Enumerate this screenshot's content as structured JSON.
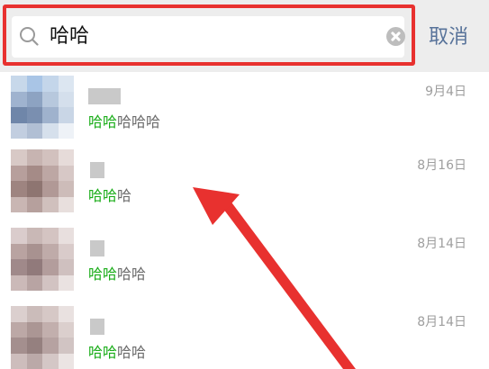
{
  "search": {
    "query": "哈哈",
    "cancel_label": "取消"
  },
  "results": [
    {
      "time": "9月4日",
      "highlight": "哈哈",
      "rest": "哈哈哈",
      "avatar_colors": [
        "#c7d8ea",
        "#a9c5e6",
        "#c4d6ea",
        "#dce6f1",
        "#9fb3cf",
        "#8da3c2",
        "#b7c8dd",
        "#d4dfec",
        "#6f86a9",
        "#7a8fb0",
        "#9fb2cd",
        "#c9d6e6",
        "#c2cee0",
        "#b1bfd4",
        "#d6e0ec",
        "#eef2f7"
      ]
    },
    {
      "time": "8月16日",
      "highlight": "哈哈",
      "rest": "哈",
      "avatar_colors": [
        "#d8c9c6",
        "#c7b4b1",
        "#d2c1be",
        "#e6dbd9",
        "#b79f9c",
        "#a58b87",
        "#bda7a4",
        "#d7c8c6",
        "#9e8480",
        "#8e7571",
        "#b19996",
        "#cdbcb9",
        "#c9b6b3",
        "#b6a09d",
        "#d0c0bd",
        "#e8dfdd"
      ]
    },
    {
      "time": "8月14日",
      "highlight": "哈哈",
      "rest": "哈哈",
      "avatar_colors": [
        "#dacccc",
        "#c9b8b6",
        "#d4c4c2",
        "#e8dfde",
        "#b9a3a1",
        "#a89290",
        "#bfaba9",
        "#d9cbca",
        "#a0898a",
        "#917a7b",
        "#b39d9c",
        "#cfc0bf",
        "#cbb9b8",
        "#b8a4a3",
        "#d2c3c2",
        "#eae2e1"
      ]
    },
    {
      "time": "8月14日",
      "highlight": "哈哈",
      "rest": "哈哈",
      "avatar_colors": [
        "#dbcfce",
        "#cbbcba",
        "#d6c8c6",
        "#e9e1e0",
        "#bca8a6",
        "#ab9694",
        "#c2afad",
        "#dbcfcd",
        "#a48f8e",
        "#95807f",
        "#b6a2a1",
        "#d1c4c3",
        "#cdbdbc",
        "#bba9a8",
        "#d4c7c6",
        "#ebe4e3"
      ]
    }
  ],
  "colors": {
    "highlight_green": "#1aad19",
    "cancel_blue": "#58739a",
    "annotation_red": "#e8312f"
  }
}
